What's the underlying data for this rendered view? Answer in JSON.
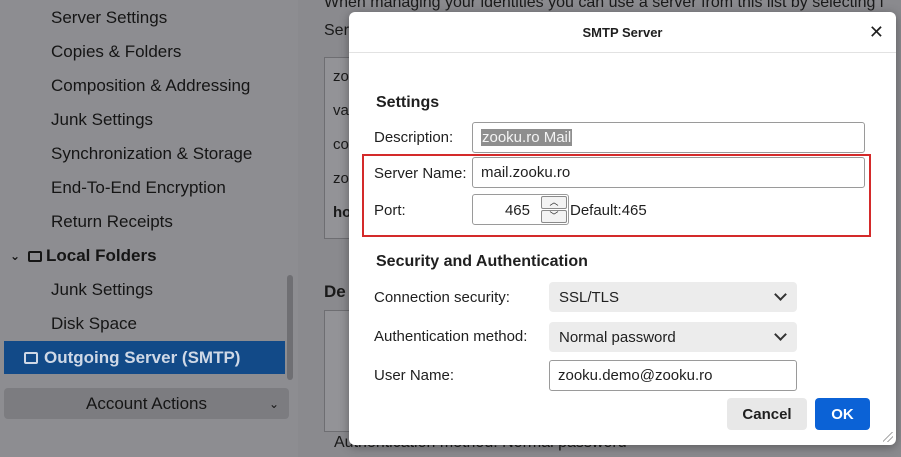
{
  "sidebar": {
    "items": [
      {
        "label": "Server Settings"
      },
      {
        "label": "Copies & Folders"
      },
      {
        "label": "Composition & Addressing"
      },
      {
        "label": "Junk Settings"
      },
      {
        "label": "Synchronization & Storage"
      },
      {
        "label": "End-To-End Encryption"
      },
      {
        "label": "Return Receipts"
      }
    ],
    "local_folders": "Local Folders",
    "local_items": [
      {
        "label": "Junk Settings"
      },
      {
        "label": "Disk Space"
      }
    ],
    "selected": "Outgoing Server (SMTP)",
    "account_actions": "Account Actions"
  },
  "background": {
    "header_text": "When managing your identities you can use a server from this list by selecting i",
    "ser": "Ser",
    "list": [
      "zo",
      "va",
      "co",
      "zo",
      "ho"
    ],
    "de": "De",
    "bottom_text": "Authentication method:  Normal password"
  },
  "dialog": {
    "title": "SMTP Server",
    "settings_heading": "Settings",
    "description_label": "Description:",
    "description_value": "zooku.ro Mail",
    "server_name_label": "Server Name:",
    "server_name_value": "mail.zooku.ro",
    "port_label": "Port:",
    "port_value": "465",
    "port_default": "Default:465",
    "security_heading": "Security and Authentication",
    "connection_security_label": "Connection security:",
    "connection_security_value": "SSL/TLS",
    "auth_method_label": "Authentication method:",
    "auth_method_value": "Normal password",
    "username_label": "User Name:",
    "username_value": "zooku.demo@zooku.ro",
    "cancel_label": "Cancel",
    "ok_label": "OK",
    "close_glyph": "✕"
  },
  "colors": {
    "accent": "#0b62d6",
    "highlight": "#d42a2a",
    "selected_bg": "#124a88"
  }
}
